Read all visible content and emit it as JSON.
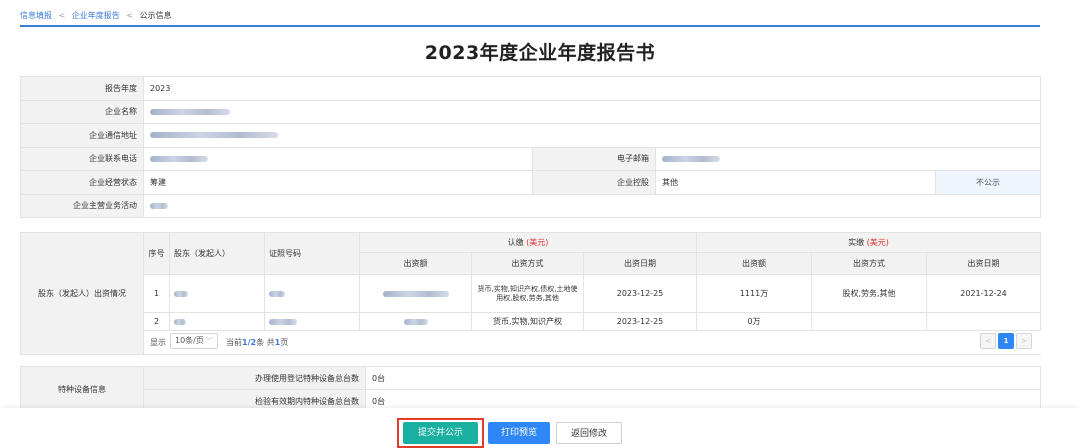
{
  "breadcrumb": {
    "item1": "信息填报",
    "item2": "企业年度报告",
    "item3": "公示信息",
    "sep": "<"
  },
  "title": "2023年度企业年度报告书",
  "basic": {
    "report_year_label": "报告年度",
    "report_year_value": "2023",
    "company_name_label": "企业名称",
    "address_label": "企业通信地址",
    "phone_label": "企业联系电话",
    "email_label": "电子邮箱",
    "status_label": "企业经营状态",
    "status_value": "筹建",
    "holding_label": "企业控股",
    "holding_value": "其他",
    "not_public": "不公示",
    "business_label": "企业主营业务活动"
  },
  "shareholders": {
    "section_label": "股东（发起人）出资情况",
    "col_seq": "序号",
    "col_holder": "股东（发起人）",
    "col_cert": "证照号码",
    "subscribed_label": "认缴",
    "paid_label": "实缴",
    "currency": "(美元)",
    "col_amount": "出资额",
    "col_method": "出资方式",
    "col_date": "出资日期",
    "rows": [
      {
        "seq": "1",
        "sub_method": "货币,实物,知识产权,债权,土地使用权,股权,劳务,其他",
        "sub_date": "2023-12-25",
        "paid_amount": "1111万",
        "paid_method": "股权,劳务,其他",
        "paid_date": "2021-12-24"
      },
      {
        "seq": "2",
        "sub_method": "货币,实物,知识产权",
        "sub_date": "2023-12-25",
        "paid_amount": "0万",
        "paid_method": "",
        "paid_date": ""
      }
    ],
    "pager": {
      "show": "显示",
      "page_size": "10条/页",
      "current_prefix": "当前",
      "current_range": "1/2",
      "current_unit": "条 共",
      "total_pages": "1",
      "total_suffix": "页",
      "prev": "<",
      "page": "1",
      "next": ">"
    }
  },
  "equipment": {
    "section_label": "特种设备信息",
    "row1_label": "办理使用登记特种设备总台数",
    "row1_value": "0台",
    "row2_label": "检验有效期内特种设备总台数",
    "row2_value": "0台"
  },
  "footer": {
    "submit": "提交并公示",
    "print": "打印预览",
    "back": "返回修改"
  }
}
